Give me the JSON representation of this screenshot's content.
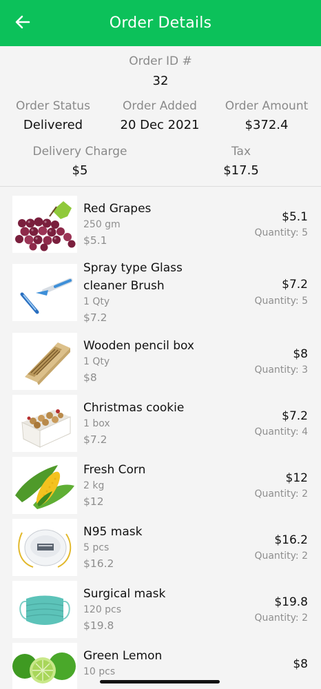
{
  "header": {
    "title": "Order Details",
    "back_icon": "arrow-left-icon"
  },
  "summary": {
    "order_id_label": "Order ID #",
    "order_id": "32",
    "order_status_label": "Order Status",
    "order_status": "Delivered",
    "order_added_label": "Order Added",
    "order_added": "20 Dec 2021",
    "order_amount_label": "Order Amount",
    "order_amount": "$372.4",
    "delivery_charge_label": "Delivery Charge",
    "delivery_charge": "$5",
    "tax_label": "Tax",
    "tax": "$17.5"
  },
  "items": [
    {
      "name": "Red Grapes",
      "unit": "250 gm",
      "sub_price": "$5.1",
      "price": "$5.1",
      "quantity": "Quantity: 5"
    },
    {
      "name_line1": "Spray type Glass",
      "name_line2": "cleaner Brush",
      "unit": "1 Qty",
      "sub_price": "$7.2",
      "price": "$7.2",
      "quantity": "Quantity: 5"
    },
    {
      "name": "Wooden pencil box",
      "unit": "1 Qty",
      "sub_price": "$8",
      "price": "$8",
      "quantity": "Quantity: 3"
    },
    {
      "name": "Christmas cookie",
      "unit": "1 box",
      "sub_price": "$7.2",
      "price": "$7.2",
      "quantity": "Quantity: 4"
    },
    {
      "name": "Fresh Corn",
      "unit": "2 kg",
      "sub_price": "$12",
      "price": "$12",
      "quantity": "Quantity: 2"
    },
    {
      "name": "N95 mask",
      "unit": "5 pcs",
      "sub_price": "$16.2",
      "price": "$16.2",
      "quantity": "Quantity: 2"
    },
    {
      "name": "Surgical mask",
      "unit": "120 pcs",
      "sub_price": "$19.8",
      "price": "$19.8",
      "quantity": "Quantity: 2"
    },
    {
      "name": "Green Lemon",
      "unit": "10 pcs",
      "price": "$8"
    }
  ],
  "colors": {
    "accent": "#0cc15a",
    "muted_text": "#8e8e8e"
  }
}
